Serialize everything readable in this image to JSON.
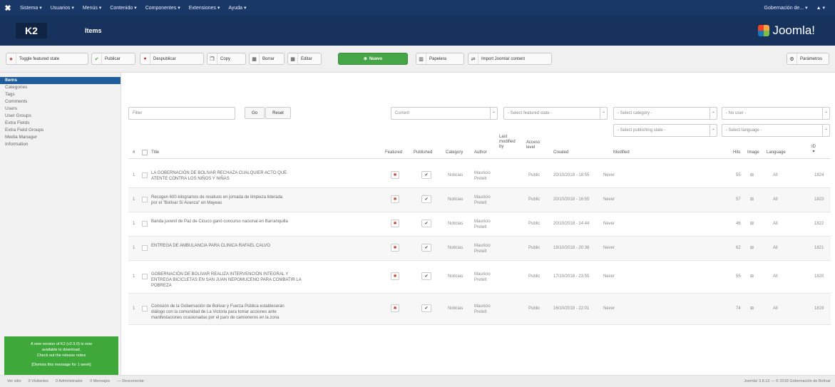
{
  "topbar": {
    "menu": [
      "Sistema ▾",
      "Usuarios ▾",
      "Menús ▾",
      "Contenido ▾",
      "Componentes ▾",
      "Extensiones ▾",
      "Ayuda ▾"
    ],
    "user": "Gobernación de... ▾",
    "user_icon": "▲ ▾"
  },
  "header": {
    "logo": "K2",
    "title": "Items",
    "brand": "Joomla!"
  },
  "toolbar": {
    "toggle_featured": "Toggle featured state",
    "publish": "Publicar",
    "unpublish": "Despublicar",
    "copy": "Copy",
    "borrar": "Borrar",
    "editar": "Editar",
    "nuevo": "Nuevo",
    "papelera": "Papelera",
    "import": "Import Joomla! content",
    "parametros": "Parámetros"
  },
  "sidebar": {
    "items": [
      "Items",
      "Categories",
      "Tags",
      "Comments",
      "Users",
      "User Groups",
      "Extra Fields",
      "Extra Field Groups",
      "Media Manager",
      "Information"
    ],
    "notice": [
      "A new version of K2 (v2.9.0) is now",
      "available to download.",
      "Check out the release notes",
      "",
      "[Dismiss this message for 1 week]"
    ]
  },
  "filters": {
    "search_placeholder": "Filter",
    "go": "Go",
    "reset": "Reset",
    "state": "Current",
    "featured": "- Select featured state -",
    "category": "- Select category -",
    "user": "- No user -",
    "published": "- Select publishing state -",
    "language": "- Select language -"
  },
  "columns": {
    "num": "#",
    "title": "Title",
    "featured": "Featured",
    "published": "Published",
    "category": "Category",
    "author": "Author",
    "last_modified": [
      "Last",
      "modified",
      "by"
    ],
    "access": [
      "Access",
      "level"
    ],
    "created": "Created",
    "modified": "Modified",
    "hits": "Hits",
    "image": "Image",
    "language": "Language",
    "id": [
      "ID",
      "▾"
    ]
  },
  "rows": [
    {
      "num": "1",
      "title": [
        "LA GOBERNACIÓN DE BOLIVAR RECHAZA CUALQUIER ACTO QUE",
        "ATENTE CONTRA LOS NIÑOS Y NIÑAS"
      ],
      "category": "Noticias",
      "author": [
        "Mauricio",
        "Pretelt"
      ],
      "access": "Public",
      "created": "20/10/2018 - 18:55",
      "modified": "Never",
      "hits": "55",
      "image": "⊞",
      "language": "All",
      "id": "1824"
    },
    {
      "num": "1",
      "title": [
        "Recogen 600 kilogramos de residuos en jornada de limpieza liderada",
        "por el \"Bolívar Sí Avanza\" en Mayeas"
      ],
      "category": "Noticias",
      "author": [
        "Mauricio",
        "Pretelt"
      ],
      "access": "Public",
      "created": "20/10/2018 - 16:55",
      "modified": "Never",
      "hits": "57",
      "image": "⊞",
      "language": "All",
      "id": "1823"
    },
    {
      "num": "1",
      "title": [
        "Banda juvenil de Paz de Cicuco ganó concurso nacional en Barranquilla"
      ],
      "category": "Noticias",
      "author": [
        "Mauricio",
        "Pretelt"
      ],
      "access": "Public",
      "created": "20/10/2018 - 14:44",
      "modified": "Never",
      "hits": "46",
      "image": "⊞",
      "language": "All",
      "id": "1822"
    },
    {
      "num": "1",
      "title": [
        "ENTREGA DE AMBULANCIA PARA CLINICA RAFAEL CALVO"
      ],
      "category": "Noticias",
      "author": [
        "Mauricio",
        "Pretelt"
      ],
      "access": "Public",
      "created": "19/10/2018 - 20:38",
      "modified": "Never",
      "hits": "62",
      "image": "⊞",
      "language": "All",
      "id": "1821"
    },
    {
      "num": "1",
      "title": [
        "GOBERNACIÓN DE BOLIVAR REALIZA INTERVENCIÓN INTEGRAL Y",
        "ENTREGA BICICLETAS EN SAN JUAN NEPOMUCENO PARA COMBATIR LA",
        "POBREZA"
      ],
      "category": "Noticias",
      "author": [
        "Mauricio",
        "Pretelt"
      ],
      "access": "Public",
      "created": "17/10/2018 - 23:55",
      "modified": "Never",
      "hits": "55",
      "image": "⊞",
      "language": "All",
      "id": "1820"
    },
    {
      "num": "1",
      "title": [
        "Comisión de la Gobernación de Bolívar y Fuerza Pública establecerán",
        "diálogo con la comunidad de La Victoria para tomar acciones ante",
        "manifestaciones ocasionadas por el paro de camioneros en la zona"
      ],
      "category": "Noticias",
      "author": [
        "Mauricio",
        "Pretelt"
      ],
      "access": "Public",
      "created": "16/10/2018 - 22:01",
      "modified": "Never",
      "hits": "74",
      "image": "⊞",
      "language": "All",
      "id": "1819"
    }
  ],
  "footer": {
    "links": [
      "Ver sitio",
      "0 Visitantes",
      "0 Administrador",
      "0 Mensajes",
      "— Desconectar"
    ],
    "copyright": "Joomla! 3.8.13 — © 2018 Gobernación de Bolívar"
  }
}
